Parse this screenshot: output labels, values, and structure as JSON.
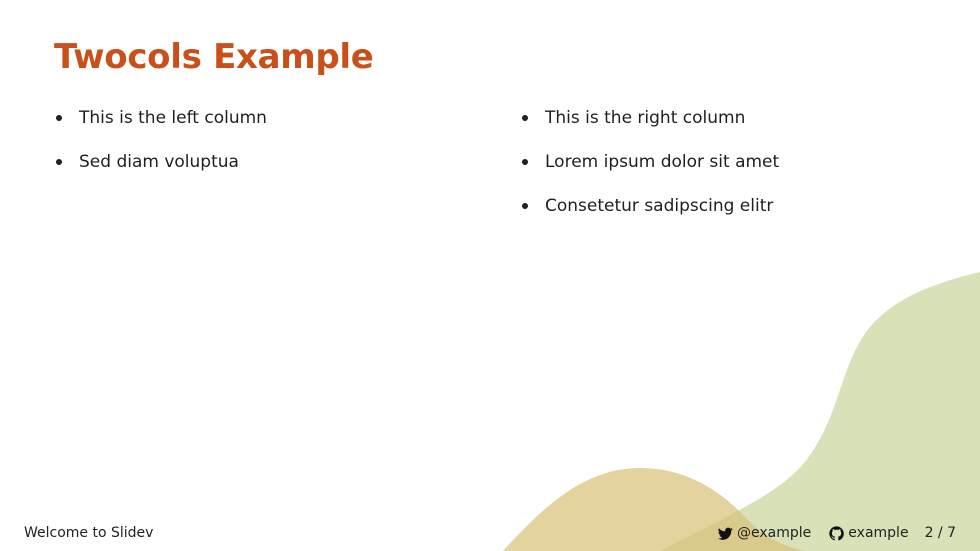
{
  "slide": {
    "title": "Twocols Example",
    "left_column": {
      "items": [
        "This is the left column",
        "Sed diam voluptua"
      ]
    },
    "right_column": {
      "items": [
        "This is the right column",
        "Lorem ipsum dolor sit amet",
        "Consetetur sadipscing elitr"
      ]
    }
  },
  "footer": {
    "presentation_title": "Welcome to Slidev",
    "twitter": {
      "icon": "twitter-icon",
      "handle": "@example"
    },
    "github": {
      "icon": "github-icon",
      "handle": "example"
    },
    "page_indicator": "2 / 7"
  },
  "colors": {
    "title": "#c8511b",
    "shape_green": "#cfdaa8",
    "shape_gold": "#d9c07a",
    "text": "#1f1f1f"
  }
}
